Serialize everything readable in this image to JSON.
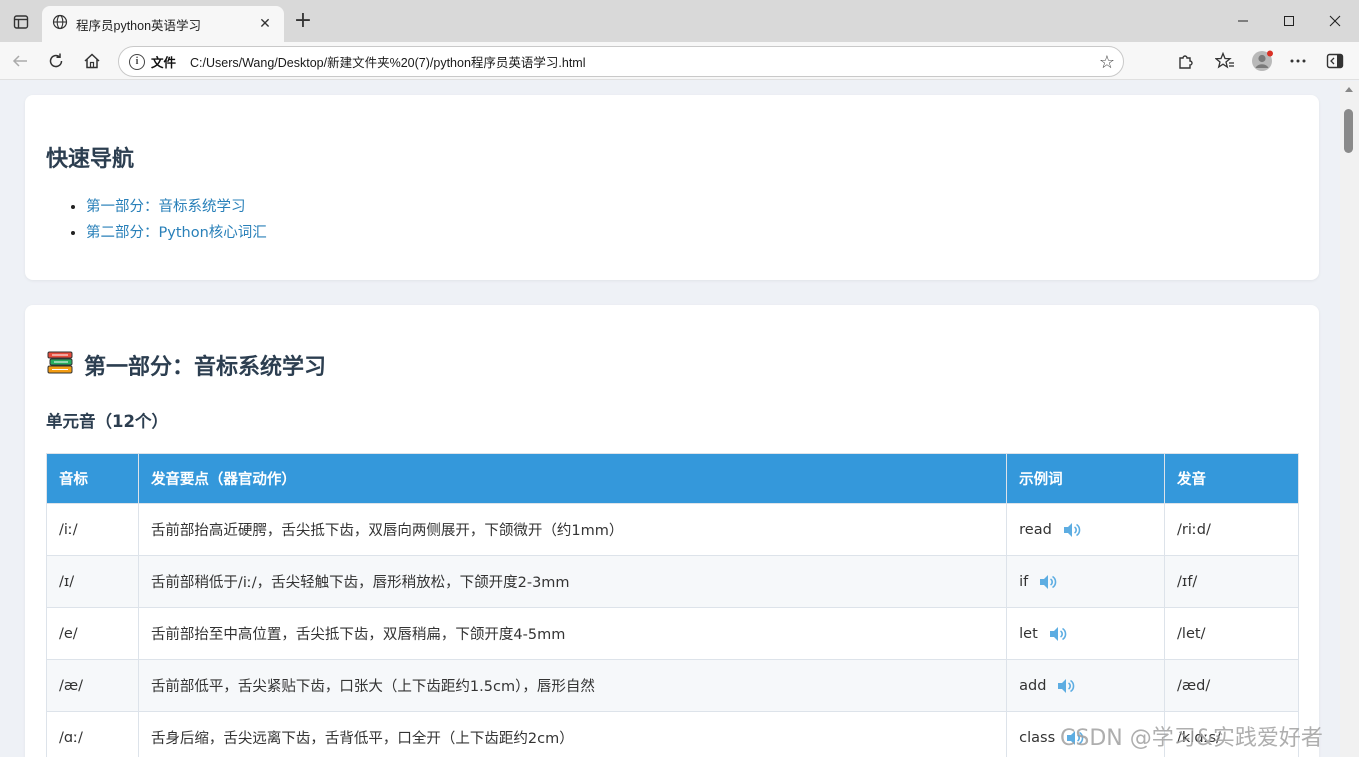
{
  "browser": {
    "tab_title": "程序员python英语学习",
    "scheme_label": "文件",
    "url": "C:/Users/Wang/Desktop/新建文件夹%20(7)/python程序员英语学习.html"
  },
  "nav": {
    "title": "快速导航",
    "links": [
      "第一部分：音标系统学习",
      "第二部分：Python核心词汇"
    ]
  },
  "part1": {
    "title": "第一部分：音标系统学习",
    "subtitle": "单元音（12个）",
    "table": {
      "headers": [
        "音标",
        "发音要点（器官动作）",
        "示例词",
        "发音"
      ],
      "rows": [
        {
          "symbol": "/iː/",
          "tip": "舌前部抬高近硬腭，舌尖抵下齿，双唇向两侧展开，下颌微开（约1mm）",
          "word": "read",
          "ipa": "/riːd/"
        },
        {
          "symbol": "/ɪ/",
          "tip": "舌前部稍低于/iː/，舌尖轻触下齿，唇形稍放松，下颌开度2-3mm",
          "word": "if",
          "ipa": "/ɪf/"
        },
        {
          "symbol": "/e/",
          "tip": "舌前部抬至中高位置，舌尖抵下齿，双唇稍扁，下颌开度4-5mm",
          "word": "let",
          "ipa": "/let/"
        },
        {
          "symbol": "/æ/",
          "tip": "舌前部低平，舌尖紧贴下齿，口张大（上下齿距约1.5cm），唇形自然",
          "word": "add",
          "ipa": "/æd/"
        },
        {
          "symbol": "/ɑː/",
          "tip": "舌身后缩，舌尖远离下齿，舌背低平，口全开（上下齿距约2cm）",
          "word": "class",
          "ipa": "/klɑːs/"
        }
      ]
    }
  },
  "watermark": "CSDN @学习&实践爱好者",
  "colors": {
    "accent": "#3498db",
    "link": "#2980b9",
    "heading": "#2c3e50"
  }
}
